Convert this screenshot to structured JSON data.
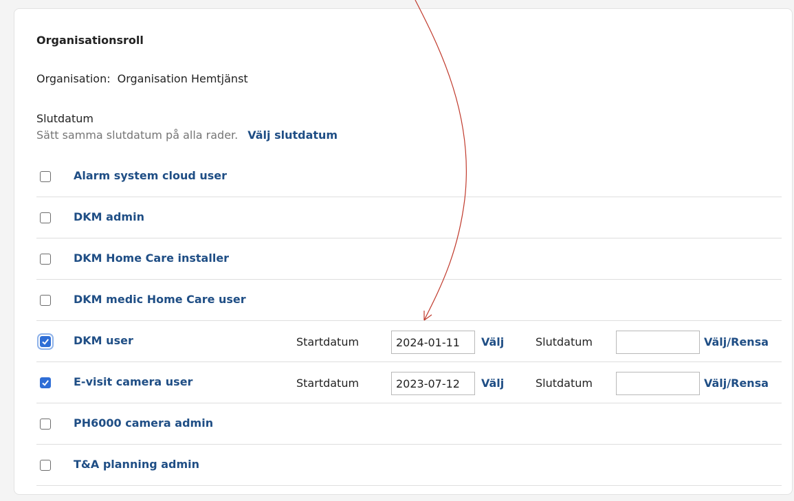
{
  "section": {
    "title": "Organisationsroll",
    "org_label": "Organisation:",
    "org_value": "Organisation Hemtjänst",
    "end_label": "Slutdatum",
    "end_hint": "Sätt samma slutdatum på alla rader.",
    "end_link": "Välj slutdatum"
  },
  "roles": [
    {
      "label": "Alarm system cloud user",
      "checked": false
    },
    {
      "label": "DKM admin",
      "checked": false
    },
    {
      "label": "DKM Home Care installer",
      "checked": false
    },
    {
      "label": "DKM medic Home Care user",
      "checked": false
    },
    {
      "label": "DKM user",
      "checked": true,
      "start_label": "Startdatum",
      "start_value": "2024-01-11",
      "start_pick": "Välj",
      "end_label": "Slutdatum",
      "end_value": "",
      "end_pick": "Välj",
      "end_clear": "Rensa"
    },
    {
      "label": "E-visit camera user",
      "checked": true,
      "start_label": "Startdatum",
      "start_value": "2023-07-12",
      "start_pick": "Välj",
      "end_label": "Slutdatum",
      "end_value": "",
      "end_pick": "Välj",
      "end_clear": "Rensa"
    },
    {
      "label": "PH6000 camera admin",
      "checked": false
    },
    {
      "label": "T&A planning admin",
      "checked": false
    }
  ],
  "colors": {
    "link": "#1f4e85",
    "checkbox_checked": "#2f6ed6",
    "annotation_arrow": "#c0392b"
  }
}
